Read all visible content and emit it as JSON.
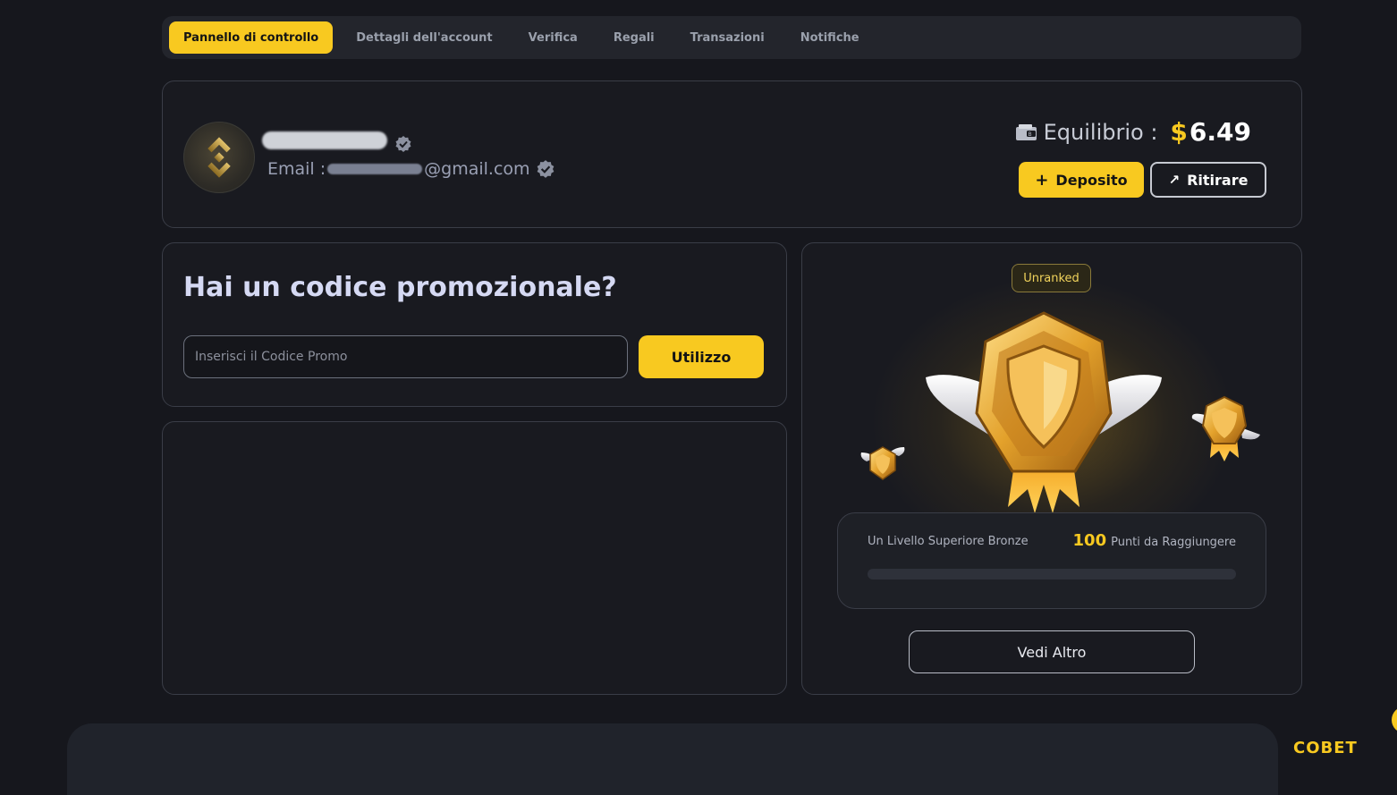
{
  "tabs": [
    {
      "label": "Pannello di controllo",
      "active": true
    },
    {
      "label": "Dettagli dell'account",
      "active": false
    },
    {
      "label": "Verifica",
      "active": false
    },
    {
      "label": "Regali",
      "active": false
    },
    {
      "label": "Transazioni",
      "active": false
    },
    {
      "label": "Notifiche",
      "active": false
    }
  ],
  "profile": {
    "avatar_icon": "binance-logo-icon",
    "email_label": "Email :",
    "email_domain": "@gmail.com",
    "verified_icon": "verified-badge-icon"
  },
  "balance": {
    "icon": "wallet-icon",
    "label": "Equilibrio :",
    "currency": "$",
    "amount": "6.49"
  },
  "actions": {
    "deposit_label": "Deposito",
    "deposit_icon": "plus-icon",
    "withdraw_label": "Ritirare",
    "withdraw_icon": "arrow-up-right-icon"
  },
  "promo": {
    "title": "Hai un codice promozionale?",
    "placeholder": "Inserisci il Codice Promo",
    "value": "",
    "apply_label": "Utilizzo"
  },
  "rank": {
    "badge": "Unranked",
    "medal_icon": "winged-shield-medal-icon",
    "next_level_text": "Un Livello Superiore Bronze",
    "points": "100",
    "points_label": "Punti da Raggiungere",
    "progress": 0,
    "see_more_label": "Vedi Altro"
  },
  "footer": {
    "logo_text": "COBET"
  },
  "colors": {
    "accent": "#f8c920",
    "background": "#16171d",
    "card": "#191a20",
    "border": "#3a3d47"
  }
}
